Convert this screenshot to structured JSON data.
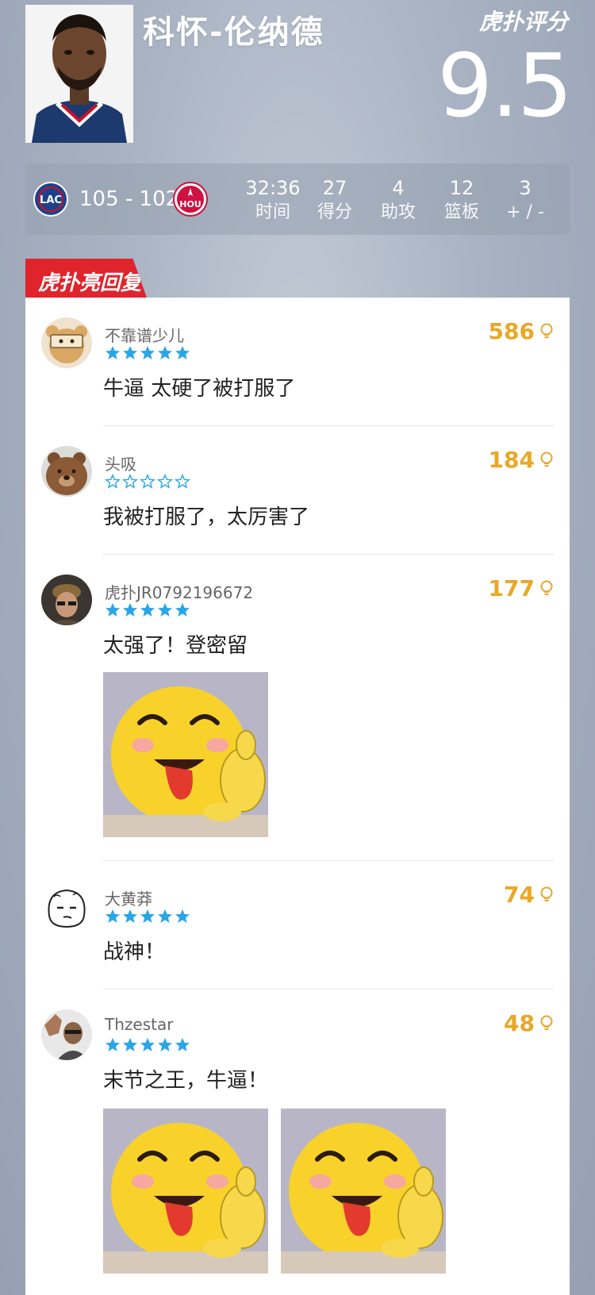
{
  "player": {
    "name": "科怀-伦纳德"
  },
  "rating": {
    "label": "虎扑评分",
    "value": "9.5"
  },
  "game": {
    "home_team": "LAC",
    "away_team": "HOU",
    "score": "105 - 102",
    "stats": [
      {
        "value": "32:36",
        "label": "时间"
      },
      {
        "value": "27",
        "label": "得分"
      },
      {
        "value": "4",
        "label": "助攻"
      },
      {
        "value": "12",
        "label": "篮板"
      },
      {
        "value": "3",
        "label": "+ / -"
      }
    ]
  },
  "highlight_tag": "虎扑亮回复",
  "colors": {
    "tag_red": "#e0242c",
    "likes_gold": "#e8a828",
    "star_blue": "#2aa6e8"
  },
  "comments": [
    {
      "user": "不靠谱少儿",
      "stars": 5,
      "likes": "586",
      "text": "牛逼 太硬了被打服了"
    },
    {
      "user": "头吸",
      "stars": 0,
      "likes": "184",
      "text": "我被打服了，太厉害了"
    },
    {
      "user": "虎扑JR0792196672",
      "stars": 5,
      "likes": "177",
      "text": "太强了！登密留"
    },
    {
      "user": "大黄莽",
      "stars": 5,
      "likes": "74",
      "text": "战神！"
    },
    {
      "user": "Thzestar",
      "stars": 5,
      "likes": "48",
      "text": "末节之王，牛逼！"
    }
  ]
}
